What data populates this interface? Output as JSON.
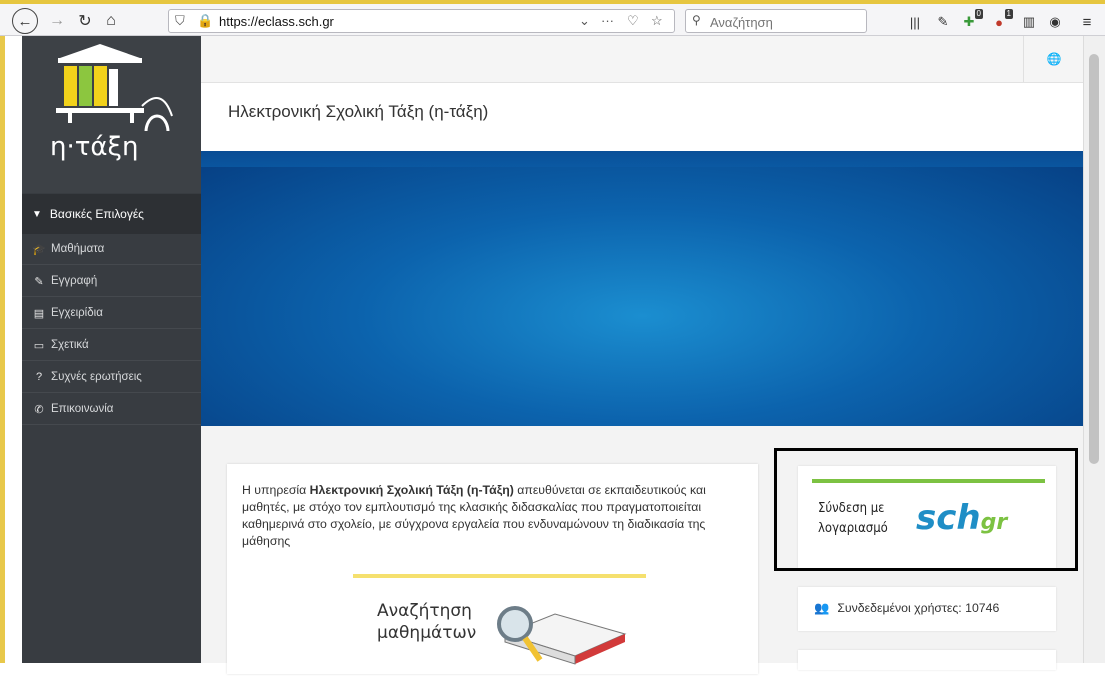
{
  "browser": {
    "url": "https://eclass.sch.gr",
    "search_placeholder": "Αναζήτηση",
    "badges": {
      "ext1": "0",
      "ext2": "1"
    }
  },
  "site": {
    "logo_text": "η·τάξη",
    "title": "Ηλεκτρονική Σχολική Τάξη (η-τάξη)"
  },
  "sidebar": {
    "header": "Βασικές Επιλογές",
    "items": [
      {
        "label": "Μαθήματα",
        "icon": "graduation-cap-icon",
        "glyph": "🎓"
      },
      {
        "label": "Εγγραφή",
        "icon": "edit-icon",
        "glyph": "✎"
      },
      {
        "label": "Εγχειρίδια",
        "icon": "file-icon",
        "glyph": "▤"
      },
      {
        "label": "Σχετικά",
        "icon": "credit-card-icon",
        "glyph": "▭"
      },
      {
        "label": "Συχνές ερωτήσεις",
        "icon": "question-circle-icon",
        "glyph": "?"
      },
      {
        "label": "Επικοινωνία",
        "icon": "phone-icon",
        "glyph": "✆"
      }
    ]
  },
  "intro": {
    "bold": "Ηλεκτρονική Σχολική Τάξη (η-Τάξη)",
    "prefix": "Η υπηρεσία ",
    "suffix": " απευθύνεται σε εκπαιδευτικούς και μαθητές, με στόχο τον εμπλουτισμό της κλασικής διδασκαλίας που πραγματοποιείται καθημερινά στο σχολείο, με σύγχρονα εργαλεία που ενδυναμώνουν τη διαδικασία της μάθησης"
  },
  "course_search": {
    "label": "Αναζήτηση μαθημάτων"
  },
  "login": {
    "label": "Σύνδεση με λογαριασμό",
    "brand": "sch",
    "brand_suffix": "gr"
  },
  "online": {
    "label": "Συνδεδεμένοι χρήστες: 10746"
  },
  "colors": {
    "accent_green": "#7cc242",
    "accent_yellow": "#f5e06e",
    "sidebar": "#383c41",
    "banner": "#0c63ad",
    "highlight_border": "#000000"
  }
}
